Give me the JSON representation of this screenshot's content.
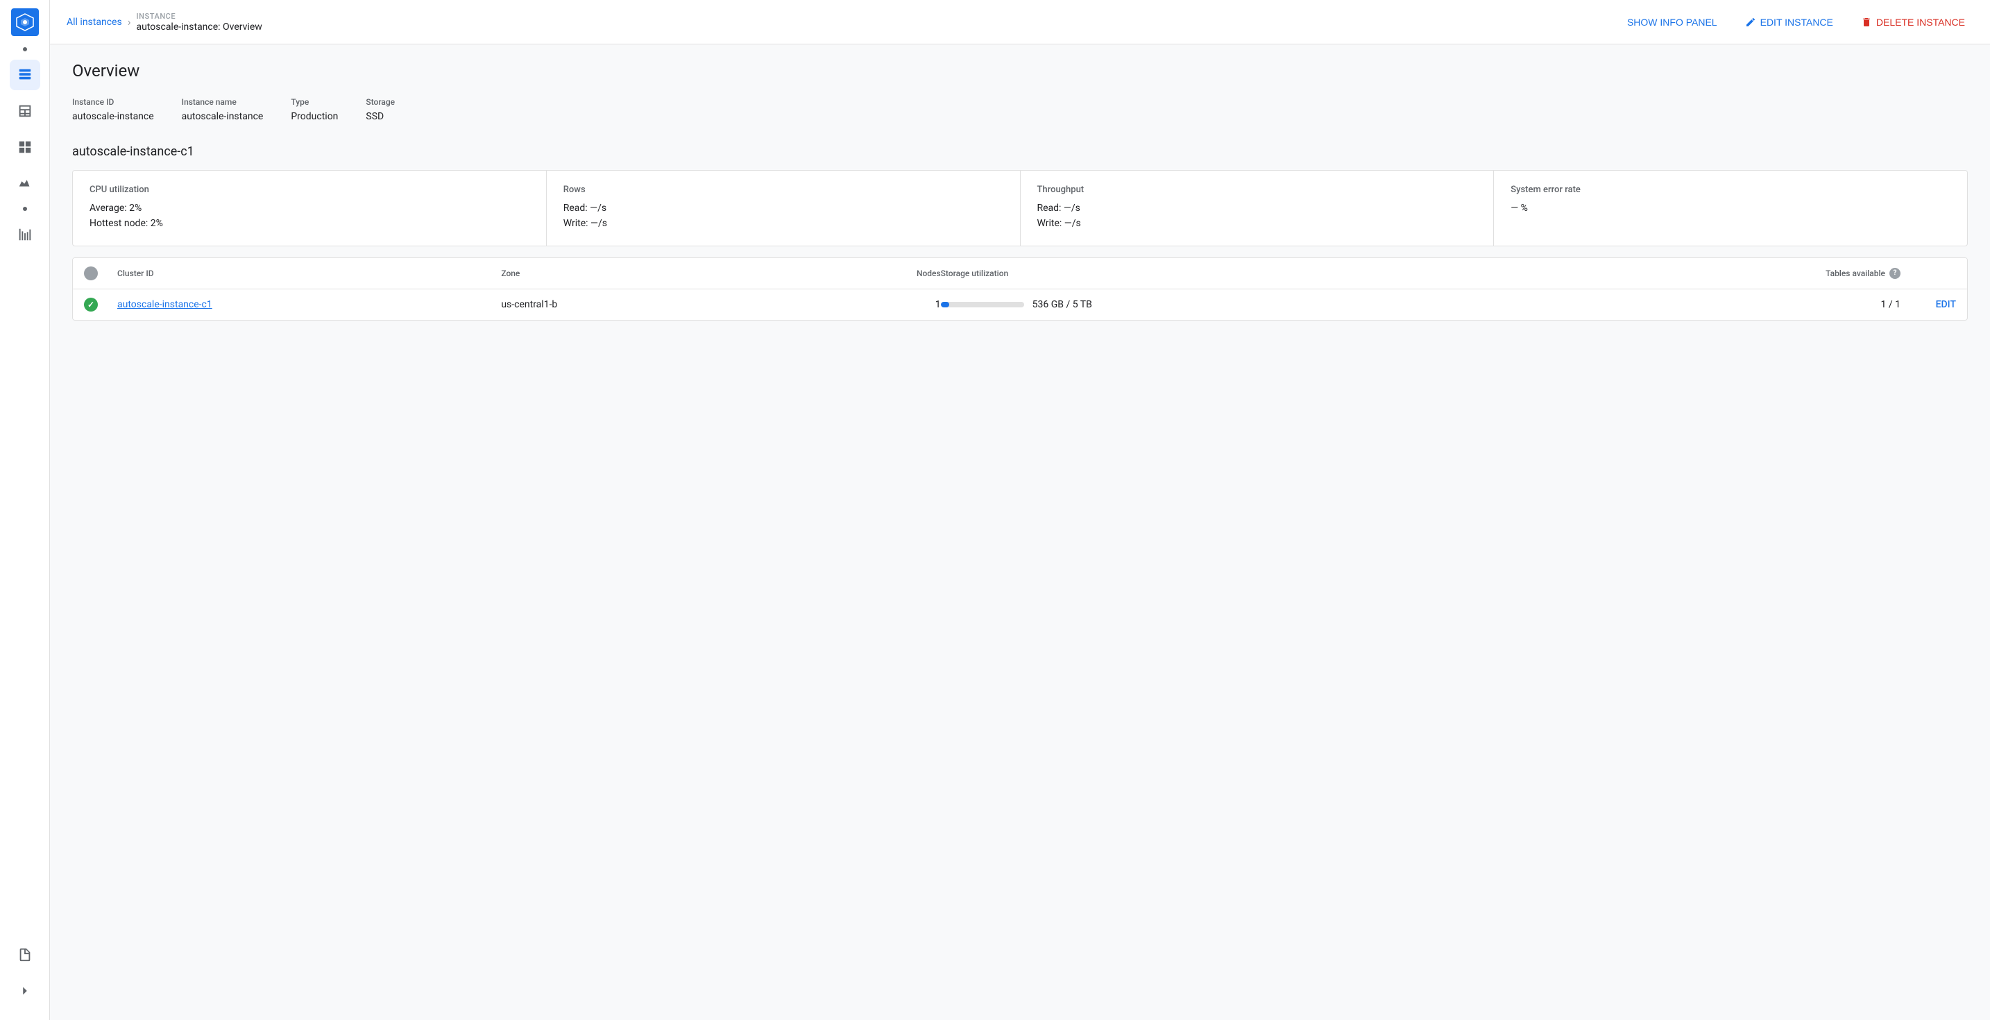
{
  "app": {
    "logo_alt": "Cloud Spanner"
  },
  "sidebar": {
    "items": [
      {
        "id": "nav-dot-1",
        "icon": "dot",
        "active": false
      },
      {
        "id": "nav-instances",
        "icon": "instances",
        "active": true
      },
      {
        "id": "nav-table",
        "icon": "table",
        "active": false
      },
      {
        "id": "nav-grid",
        "icon": "grid",
        "active": false
      },
      {
        "id": "nav-chart",
        "icon": "chart",
        "active": false
      },
      {
        "id": "nav-dot-2",
        "icon": "dot",
        "active": false
      },
      {
        "id": "nav-metrics",
        "icon": "metrics",
        "active": false
      }
    ],
    "bottom_items": [
      {
        "id": "nav-doc",
        "icon": "doc"
      },
      {
        "id": "nav-expand",
        "icon": "expand"
      }
    ]
  },
  "topbar": {
    "breadcrumb_link": "All instances",
    "breadcrumb_sep": "›",
    "breadcrumb_label": "INSTANCE",
    "breadcrumb_title": "autoscale-instance: Overview",
    "show_info_panel": "SHOW INFO PANEL",
    "edit_instance": "EDIT INSTANCE",
    "delete_instance": "DELETE INSTANCE"
  },
  "page": {
    "title": "Overview"
  },
  "instance_info": {
    "headers": [
      "Instance ID",
      "Instance name",
      "Type",
      "Storage"
    ],
    "values": [
      "autoscale-instance",
      "autoscale-instance",
      "Production",
      "SSD"
    ]
  },
  "cluster": {
    "title": "autoscale-instance-c1",
    "metrics": {
      "cpu": {
        "label": "CPU utilization",
        "average": "Average: 2%",
        "hottest": "Hottest node: 2%"
      },
      "rows": {
        "label": "Rows",
        "read": "Read: —/s",
        "write": "Write: —/s"
      },
      "throughput": {
        "label": "Throughput",
        "read": "Read: —/s",
        "write": "Write: —/s"
      },
      "error_rate": {
        "label": "System error rate",
        "value": "— %"
      }
    },
    "table": {
      "headers": {
        "status": "",
        "cluster_id": "Cluster ID",
        "zone": "Zone",
        "nodes": "Nodes",
        "storage_util": "Storage utilization",
        "tables_available": "Tables available",
        "action": ""
      },
      "rows": [
        {
          "status": "green",
          "cluster_id": "autoscale-instance-c1",
          "zone": "us-central1-b",
          "nodes": "1",
          "storage_used": "536 GB / 5 TB",
          "storage_pct": 10.7,
          "tables": "1 / 1",
          "action": "EDIT"
        }
      ]
    }
  }
}
